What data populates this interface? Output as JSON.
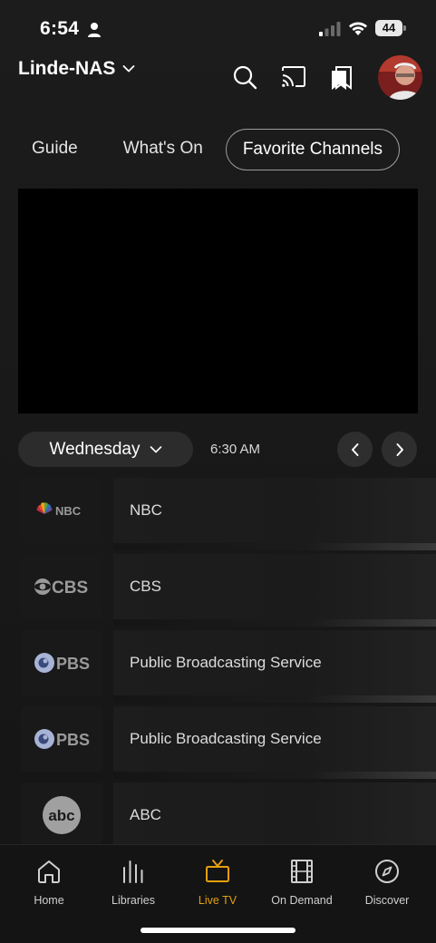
{
  "status_bar": {
    "time": "6:54",
    "battery": "44"
  },
  "header": {
    "server_name": "Linde-NAS"
  },
  "tabs": [
    {
      "label": "Guide",
      "active": false
    },
    {
      "label": "What's On",
      "active": false
    },
    {
      "label": "Favorite Channels",
      "active": true
    }
  ],
  "guide": {
    "day": "Wednesday",
    "time": "6:30 AM"
  },
  "channels": [
    {
      "logo_text": "NBC",
      "name": "NBC",
      "logo": "nbc-logo"
    },
    {
      "logo_text": "CBS",
      "name": "CBS",
      "logo": "cbs-logo"
    },
    {
      "logo_text": "PBS",
      "name": "Public Broadcasting Service",
      "logo": "pbs-logo"
    },
    {
      "logo_text": "PBS",
      "name": "Public Broadcasting Service",
      "logo": "pbs-logo"
    },
    {
      "logo_text": "abc",
      "name": "ABC",
      "logo": "abc-logo"
    }
  ],
  "bottom_nav": [
    {
      "label": "Home",
      "icon": "home-icon",
      "active": false
    },
    {
      "label": "Libraries",
      "icon": "libraries-icon",
      "active": false
    },
    {
      "label": "Live TV",
      "icon": "tv-icon",
      "active": true
    },
    {
      "label": "On Demand",
      "icon": "film-icon",
      "active": false
    },
    {
      "label": "Discover",
      "icon": "compass-icon",
      "active": false
    }
  ],
  "colors": {
    "accent": "#e5a00d",
    "background": "#1a1a1a",
    "player": "#000000"
  }
}
